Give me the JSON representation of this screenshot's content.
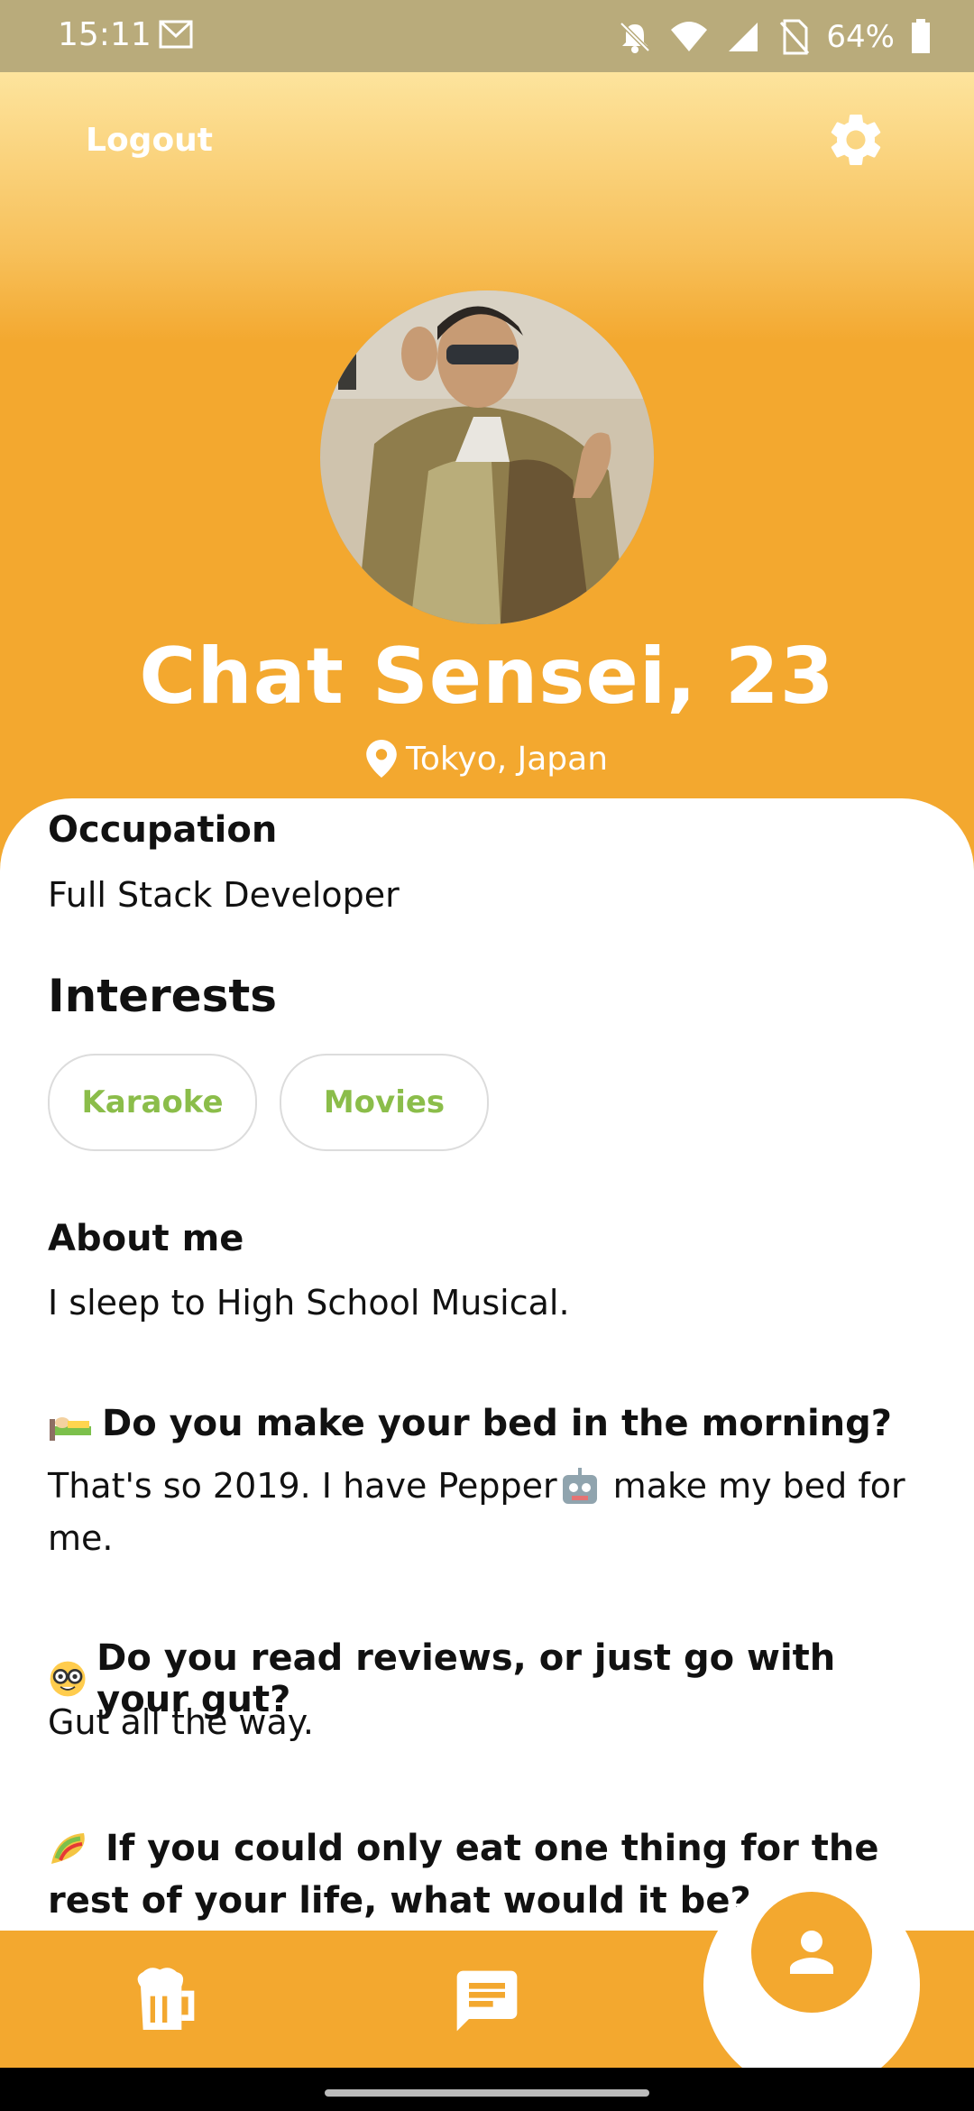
{
  "status_bar": {
    "time": "15:11",
    "battery": "64%"
  },
  "header": {
    "logout_label": "Logout"
  },
  "profile": {
    "name_age": "Chat Sensei,  23",
    "location": "Tokyo, Japan"
  },
  "occupation": {
    "label": "Occupation",
    "value": "Full Stack Developer"
  },
  "interests": {
    "heading": "Interests",
    "items": [
      "Karaoke",
      "Movies"
    ]
  },
  "about": {
    "label": "About me",
    "value": "I sleep to High School Musical."
  },
  "qa": [
    {
      "emoji": "bed-emoji",
      "question": "Do you make your bed in the morning?",
      "answer_part1": "That's so 2019. I have Pepper",
      "answer_part2": " make my bed for me."
    },
    {
      "emoji": "nerd-face-emoji",
      "question": "Do you read reviews, or just go with your gut?",
      "answer": "Gut all the way."
    },
    {
      "emoji": "taco-emoji",
      "question": "If you could only eat one thing for the rest of your life, what would it be?"
    }
  ],
  "colors": {
    "accent": "#f3a82f",
    "chip_text": "#8bbd4a",
    "status_bar": "#b9ab7b"
  },
  "icons": [
    "mail-icon",
    "bell-off-icon",
    "wifi-icon",
    "signal-icon",
    "no-sim-icon",
    "battery-icon",
    "gear-icon",
    "location-pin-icon",
    "beer-icon",
    "chat-icon",
    "profile-icon"
  ]
}
